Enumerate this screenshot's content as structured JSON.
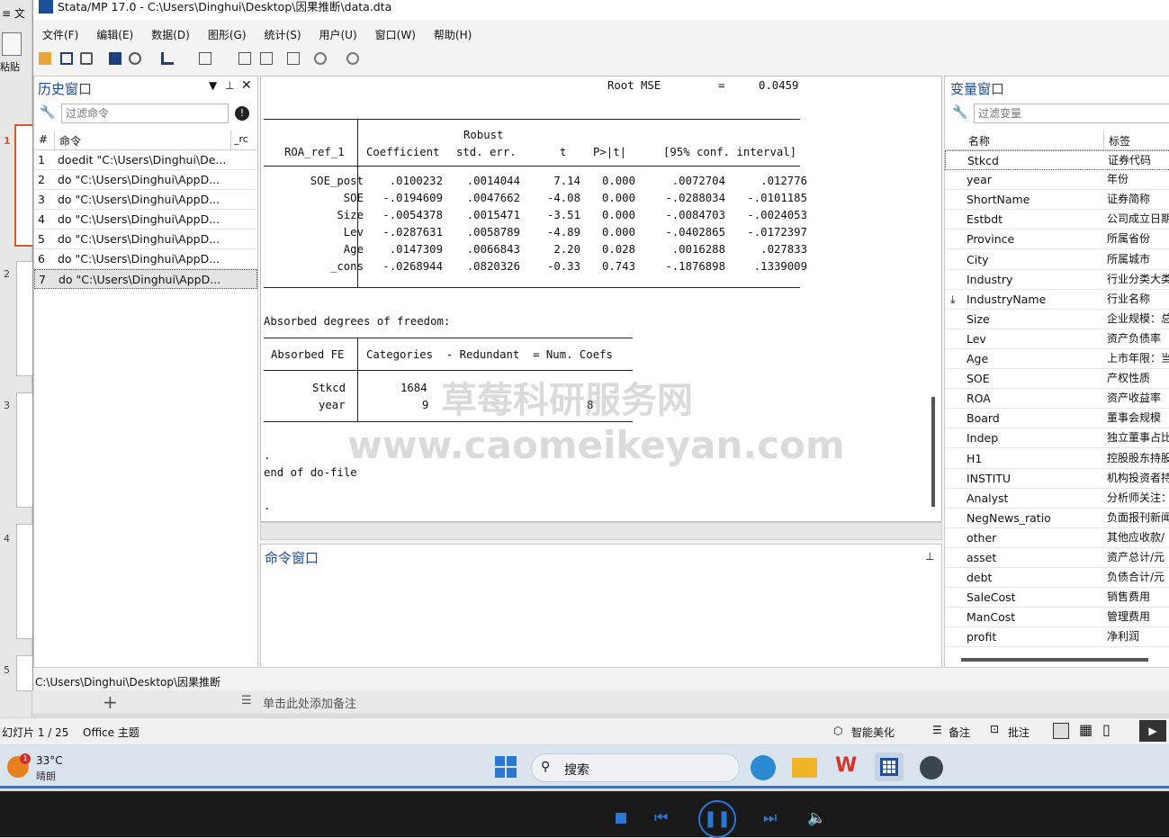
{
  "ppt": {
    "top_left": "≡ 文",
    "paste": "粘贴",
    "slide_nums": [
      "1",
      "2",
      "3",
      "4",
      "5"
    ],
    "slide_counter": "幻灯片 1 / 25",
    "theme": "Office 主题",
    "notes_placeholder": "单击此处添加备注",
    "status_right": [
      "智能美化",
      "备注",
      "批注"
    ]
  },
  "taskbar": {
    "temp": "33°C",
    "weather": "晴朗",
    "search": "搜索"
  },
  "stata": {
    "title": "Stata/MP 17.0 - C:\\Users\\Dinghui\\Desktop\\因果推断\\data.dta",
    "menu": [
      "文件(F)",
      "编辑(E)",
      "数据(D)",
      "图形(G)",
      "统计(S)",
      "用户(U)",
      "窗口(W)",
      "帮助(H)"
    ],
    "history": {
      "title": "历史窗口",
      "filter_placeholder": "过滤命令",
      "col_num": "#",
      "col_cmd": "命令",
      "col_rc": "_rc",
      "rows": [
        {
          "n": "1",
          "cmd": "doedit \"C:\\Users\\Dinghui\\De..."
        },
        {
          "n": "2",
          "cmd": "do \"C:\\Users\\Dinghui\\AppD..."
        },
        {
          "n": "3",
          "cmd": "do \"C:\\Users\\Dinghui\\AppD..."
        },
        {
          "n": "4",
          "cmd": "do \"C:\\Users\\Dinghui\\AppD..."
        },
        {
          "n": "5",
          "cmd": "do \"C:\\Users\\Dinghui\\AppD..."
        },
        {
          "n": "6",
          "cmd": "do \"C:\\Users\\Dinghui\\AppD..."
        },
        {
          "n": "7",
          "cmd": "do \"C:\\Users\\Dinghui\\AppD..."
        }
      ]
    },
    "results": {
      "root_mse_label": "Root MSE",
      "root_mse_eq": "=",
      "root_mse_val": "0.0459",
      "hdr_robust": "Robust",
      "hdr_dep": "ROA_ref_1",
      "hdr_coef": "Coefficient",
      "hdr_se": "std. err.",
      "hdr_t": "t",
      "hdr_p": "P>|t|",
      "hdr_ci": "[95% conf. interval]",
      "rows": [
        {
          "var": "SOE_post",
          "coef": ".0100232",
          "se": ".0014044",
          "t": "7.14",
          "p": "0.000",
          "lo": ".0072704",
          "hi": ".012776"
        },
        {
          "var": "SOE",
          "coef": "-.0194609",
          "se": ".0047662",
          "t": "-4.08",
          "p": "0.000",
          "lo": "-.0288034",
          "hi": "-.0101185"
        },
        {
          "var": "Size",
          "coef": "-.0054378",
          "se": ".0015471",
          "t": "-3.51",
          "p": "0.000",
          "lo": "-.0084703",
          "hi": "-.0024053"
        },
        {
          "var": "Lev",
          "coef": "-.0287631",
          "se": ".0058789",
          "t": "-4.89",
          "p": "0.000",
          "lo": "-.0402865",
          "hi": "-.0172397"
        },
        {
          "var": "Age",
          "coef": ".0147309",
          "se": ".0066843",
          "t": "2.20",
          "p": "0.028",
          "lo": ".0016288",
          "hi": ".027833"
        },
        {
          "var": "_cons",
          "coef": "-.0268944",
          "se": ".0820326",
          "t": "-0.33",
          "p": "0.743",
          "lo": "-.1876898",
          "hi": ".1339009"
        }
      ],
      "absorbed_title": "Absorbed degrees of freedom:",
      "fe_hdr_fe": "Absorbed FE",
      "fe_hdr_rest": "Categories  - Redundant  = Num. Coefs",
      "fe_rows": [
        {
          "fe": "Stkcd",
          "cat": "1684",
          "red": "",
          "num": ""
        },
        {
          "fe": "year",
          "cat": "9",
          "red": "",
          "num": "8"
        }
      ],
      "dot1": ".",
      "end_do": "end of do-file",
      "dot2": "."
    },
    "command": {
      "title": "命令窗口"
    },
    "variables": {
      "title": "变量窗口",
      "filter_placeholder": "过滤变量",
      "col_name": "名称",
      "col_label": "标签",
      "rows": [
        {
          "name": "Stkcd",
          "label": "证券代码"
        },
        {
          "name": "year",
          "label": "年份"
        },
        {
          "name": "ShortName",
          "label": "证券简称"
        },
        {
          "name": "Estbdt",
          "label": "公司成立日期"
        },
        {
          "name": "Province",
          "label": "所属省份"
        },
        {
          "name": "City",
          "label": "所属城市"
        },
        {
          "name": "Industry",
          "label": "行业分类大类"
        },
        {
          "name": "IndustryName",
          "label": "行业名称"
        },
        {
          "name": "Size",
          "label": "企业规模：总"
        },
        {
          "name": "Lev",
          "label": "资产负债率"
        },
        {
          "name": "Age",
          "label": "上市年限：当"
        },
        {
          "name": "SOE",
          "label": "产权性质"
        },
        {
          "name": "ROA",
          "label": "资产收益率"
        },
        {
          "name": "Board",
          "label": "董事会规模"
        },
        {
          "name": "Indep",
          "label": "独立董事占比"
        },
        {
          "name": "H1",
          "label": "控股股东持股"
        },
        {
          "name": "INSTITU",
          "label": "机构投资者持"
        },
        {
          "name": "Analyst",
          "label": "分析师关注："
        },
        {
          "name": "NegNews_ratio",
          "label": "负面报刊新闻"
        },
        {
          "name": "other",
          "label": "其他应收款/"
        },
        {
          "name": "asset",
          "label": "资产总计/元"
        },
        {
          "name": "debt",
          "label": "负债合计/元"
        },
        {
          "name": "SaleCost",
          "label": "销售费用"
        },
        {
          "name": "ManCost",
          "label": "管理费用"
        },
        {
          "name": "profit",
          "label": "净利润"
        }
      ]
    },
    "path": "C:\\Users\\Dinghui\\Desktop\\因果推断"
  },
  "watermark": {
    "cn": "草莓科研服务网",
    "url": "www.caomeikeyan.com"
  },
  "colors": {
    "accent": "#1a4a9a",
    "taskbar_line": "#2b78d4"
  }
}
